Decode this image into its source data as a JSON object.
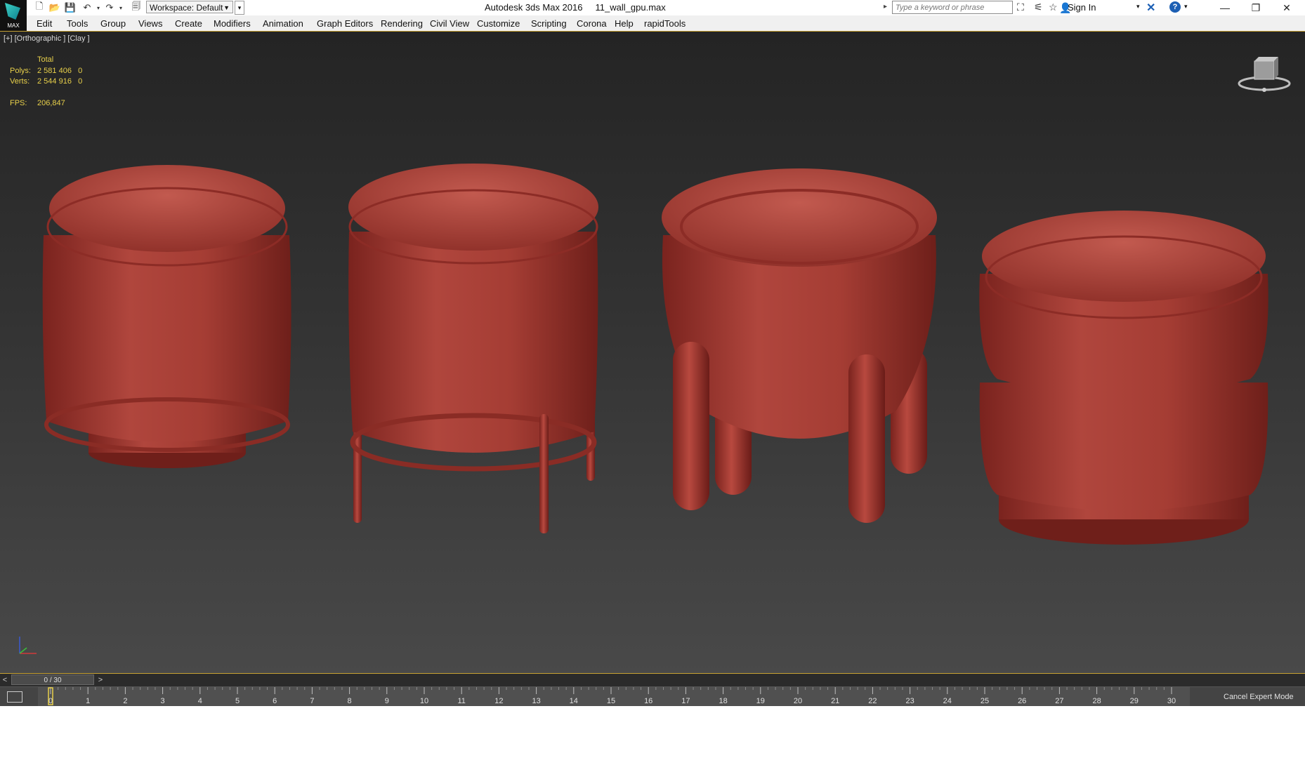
{
  "app": {
    "title": "Autodesk 3ds Max 2016     11_wall_gpu.max",
    "logo_label": "MAX"
  },
  "quick_access": {
    "workspace_label": "Workspace: Default"
  },
  "search": {
    "placeholder": "Type a keyword or phrase"
  },
  "account": {
    "signin_label": "Sign In"
  },
  "menu": {
    "items": [
      "Edit",
      "Tools",
      "Group",
      "Views",
      "Create",
      "Modifiers",
      "Animation",
      "Graph Editors",
      "Rendering",
      "Civil View",
      "Customize",
      "Scripting",
      "Corona",
      "Help",
      "rapidTools"
    ]
  },
  "viewport": {
    "label": "[+] [Orthographic ] [Clay ]",
    "stats": {
      "total_label": "Total",
      "polys_label": "Polys:",
      "polys_value": "2 581 406   0",
      "verts_label": "Verts:",
      "verts_value": "2 544 916   0",
      "fps_label": "FPS:",
      "fps_value": "206,847"
    },
    "model_color": "#a63a32"
  },
  "timeline": {
    "position_label": "0 / 30",
    "prev_label": "<",
    "next_label": ">",
    "ticks": [
      "0",
      "1",
      "2",
      "3",
      "4",
      "5",
      "6",
      "7",
      "8",
      "9",
      "10",
      "11",
      "12",
      "13",
      "14",
      "15",
      "16",
      "17",
      "18",
      "19",
      "20",
      "21",
      "22",
      "23",
      "24",
      "25",
      "26",
      "27",
      "28",
      "29",
      "30"
    ],
    "current_frame": 0
  },
  "status": {
    "cancel_expert_label": "Cancel Expert Mode"
  },
  "colors": {
    "viewport_border": "#c8a233",
    "stats_text": "#e8d04a",
    "accent_blue": "#1d5fb3"
  }
}
